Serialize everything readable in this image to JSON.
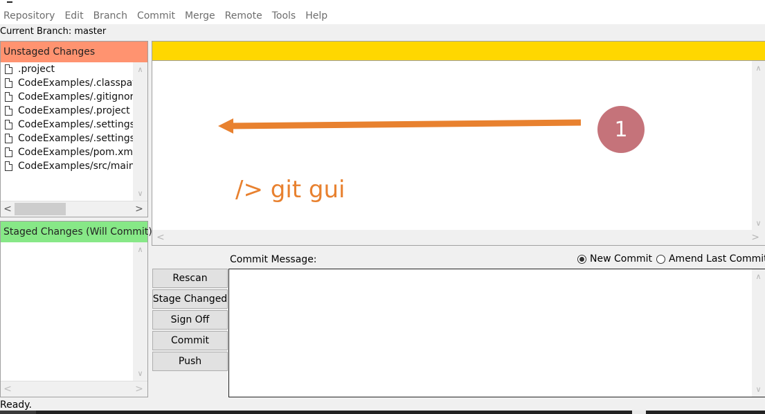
{
  "menu": [
    "Repository",
    "Edit",
    "Branch",
    "Commit",
    "Merge",
    "Remote",
    "Tools",
    "Help"
  ],
  "current_branch": "Current Branch: master",
  "unstaged": {
    "title": "Unstaged Changes",
    "color": "#ff9370",
    "files": [
      ".project",
      "CodeExamples/.classpath",
      "CodeExamples/.gitignore",
      "CodeExamples/.project",
      "CodeExamples/.settings/org.eclipse.core.resources.prefs",
      "CodeExamples/.settings/org.eclipse.jdt.core.prefs",
      "CodeExamples/pom.xml",
      "CodeExamples/src/main/"
    ]
  },
  "staged": {
    "title": "Staged Changes (Will Commit)",
    "color": "#87e887",
    "files": []
  },
  "diff": {
    "header_color": "#ffd700",
    "annotation_text": "/> git gui",
    "step_number": "1",
    "annotation_color": "#e8812f",
    "badge_color": "#c5737a"
  },
  "commit": {
    "label": "Commit Message:",
    "message": "",
    "options": [
      {
        "label": "New Commit",
        "selected": true
      },
      {
        "label": "Amend Last Commit",
        "selected": false
      }
    ]
  },
  "buttons": [
    "Rescan",
    "Stage Changed",
    "Sign Off",
    "Commit",
    "Push"
  ],
  "scroll_icons": {
    "up": "∧",
    "down": "∨",
    "left": "<",
    "right": ">"
  },
  "status": "Ready."
}
